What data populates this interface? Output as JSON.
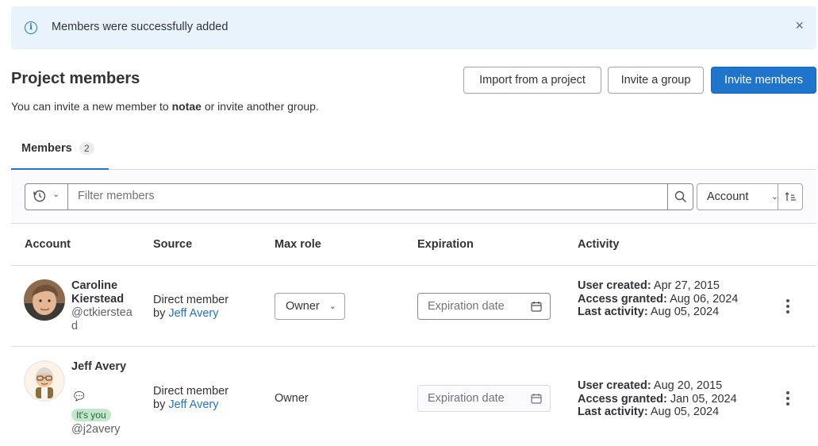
{
  "alert": {
    "message": "Members were successfully added",
    "close": "×"
  },
  "page": {
    "title": "Project members",
    "subtitle_pre": "You can invite a new member to ",
    "subtitle_project": "notae",
    "subtitle_post": " or invite another group."
  },
  "buttons": {
    "import": "Import from a project",
    "invite_group": "Invite a group",
    "invite_members": "Invite members"
  },
  "tabs": [
    {
      "label": "Members",
      "count": "2"
    }
  ],
  "filter": {
    "placeholder": "Filter members",
    "sort_label": "Account"
  },
  "table": {
    "headers": [
      "Account",
      "Source",
      "Max role",
      "Expiration",
      "Activity"
    ],
    "rows": [
      {
        "name": "Caroline Kierstead",
        "handle": "@ctkierstead",
        "source_prefix": "Direct member",
        "source_by": "by ",
        "source_user": "Jeff Avery",
        "role": "Owner",
        "expiration_placeholder": "Expiration date",
        "user_created_label": "User created:",
        "user_created": "Apr 27, 2015",
        "access_granted_label": "Access granted:",
        "access_granted": "Aug 06, 2024",
        "last_activity_label": "Last activity:",
        "last_activity": "Aug 05, 2024"
      },
      {
        "name": "Jeff Avery",
        "handle": "@j2avery",
        "badge": "It's you",
        "source_prefix": "Direct member",
        "source_by": "by ",
        "source_user": "Jeff Avery",
        "role": "Owner",
        "expiration_placeholder": "Expiration date",
        "user_created_label": "User created:",
        "user_created": "Aug 20, 2015",
        "access_granted_label": "Access granted:",
        "access_granted": "Jan 05, 2024",
        "last_activity_label": "Last activity:",
        "last_activity": "Aug 05, 2024"
      }
    ]
  },
  "colors": {
    "primary": "#1f75cb",
    "alert_bg": "#e9f3fc",
    "badge_bg": "#c3e6cd"
  }
}
